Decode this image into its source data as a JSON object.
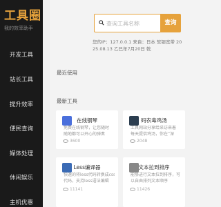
{
  "sidebar": {
    "logo_text": "工具圈",
    "logo_sub": "我的效率助手",
    "items": [
      {
        "label": "开发工具"
      },
      {
        "label": "站长工具"
      },
      {
        "label": "提升效率"
      },
      {
        "label": "便民查询"
      },
      {
        "label": "媒体处理"
      },
      {
        "label": "休闲娱乐"
      },
      {
        "label": "主机优惠"
      }
    ]
  },
  "search": {
    "placeholder": "查询工具名称",
    "button_label": "查询"
  },
  "info": {
    "line1": "您的IP：127.0.0.1 来自：日本 软银宽带 20",
    "line2": "25.08.13 乙巳年7月20日 乾"
  },
  "recent": {
    "title": "最近使用"
  },
  "latest": {
    "title": "最新工具",
    "cards": [
      {
        "title": "在线钢琴",
        "desc": [
          "免费在线钢琴，让您随时",
          "随地都可以开心的弹奏"
        ],
        "views": "3600",
        "icon_color": "#4a6fdc"
      },
      {
        "title": "码农毒鸡汤",
        "desc": [
          "工具网站分享给采访来着",
          "每天提供鸡汤，你在“深"
        ],
        "views": "2048",
        "icon_color": "#2c3e50"
      },
      {
        "title": "Less编译器",
        "desc": [
          "快速的将less代码转换成css",
          "代码，支持less语法编辑"
        ],
        "views": "11141",
        "icon_color": "#3b6bb5"
      },
      {
        "title": "文本拉到排序",
        "desc": [
          "能够进行文本拉到排序，可",
          "以自由排列文本顺序"
        ],
        "views": "11426",
        "icon_color": "#888888"
      }
    ]
  }
}
